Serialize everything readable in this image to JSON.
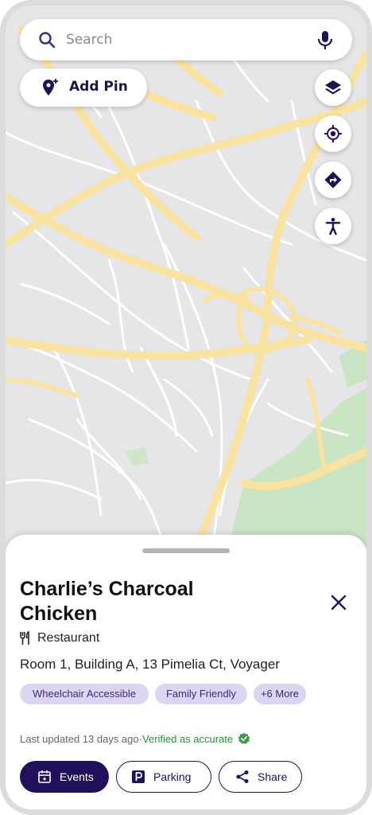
{
  "search": {
    "placeholder": "Search",
    "value": ""
  },
  "add_pin": {
    "label": "Add Pin"
  },
  "map_controls": [
    "layers-icon",
    "my-location-icon",
    "directions-icon",
    "accessibility-icon"
  ],
  "place": {
    "name": "Charlie’s Charcoal Chicken",
    "category": "Restaurant",
    "address": "Room 1, Building A, 13 Pimelia Ct, Voyager",
    "tags": [
      "Wheelchair Accessible",
      "Family Friendly",
      "+6 More"
    ],
    "last_updated": "Last updated 13 days ago",
    "separator": " · ",
    "verified": "Verified as accurate"
  },
  "actions": {
    "events": "Events",
    "parking": "Parking",
    "share": "Share"
  },
  "colors": {
    "brand": "#22105a",
    "chip_bg": "#ddd6f2",
    "verified": "#2f8a3f",
    "road_major": "#fbe49a",
    "park": "#c7e6c3"
  }
}
